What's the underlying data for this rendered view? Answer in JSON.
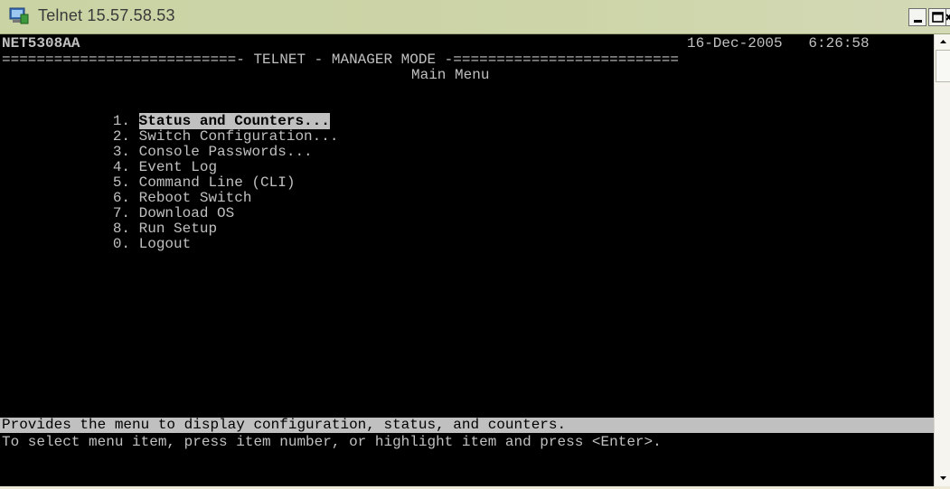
{
  "window": {
    "title": "Telnet 15.57.58.53",
    "min_glyph": "_",
    "max_glyph": "□",
    "close_glyph": "×"
  },
  "terminal": {
    "hostname": "NET5308AA",
    "date_time": "16-Dec-2005   6:26:58",
    "banner": "===========================- TELNET - MANAGER MODE -==========================",
    "menu_title": "Main Menu",
    "menu_items": [
      {
        "number": "1.",
        "label": "Status and Counters..."
      },
      {
        "number": "2.",
        "label": "Switch Configuration..."
      },
      {
        "number": "3.",
        "label": "Console Passwords..."
      },
      {
        "number": "4.",
        "label": "Event Log"
      },
      {
        "number": "5.",
        "label": "Command Line (CLI)"
      },
      {
        "number": "6.",
        "label": "Reboot Switch"
      },
      {
        "number": "7.",
        "label": "Download OS"
      },
      {
        "number": "8.",
        "label": "Run Setup"
      },
      {
        "number": "0.",
        "label": "Logout"
      }
    ],
    "selected_index": 0,
    "status_line": "Provides the menu to display configuration, status, and counters.",
    "help_line": "To select menu item, press item number, or highlight item and press <Enter>."
  },
  "colors": {
    "terminal_bg": "#000000",
    "terminal_fg": "#c0c0c0",
    "highlight_bg": "#c0c0c0",
    "highlight_fg": "#000000",
    "titlebar": "#cdd5a8"
  },
  "icons": {
    "app": "telnet-computer-icon",
    "minimize": "minimize-icon",
    "maximize": "maximize-icon",
    "close": "close-icon",
    "scroll_up": "scroll-up-arrow-icon",
    "scroll_down": "scroll-down-arrow-icon"
  }
}
